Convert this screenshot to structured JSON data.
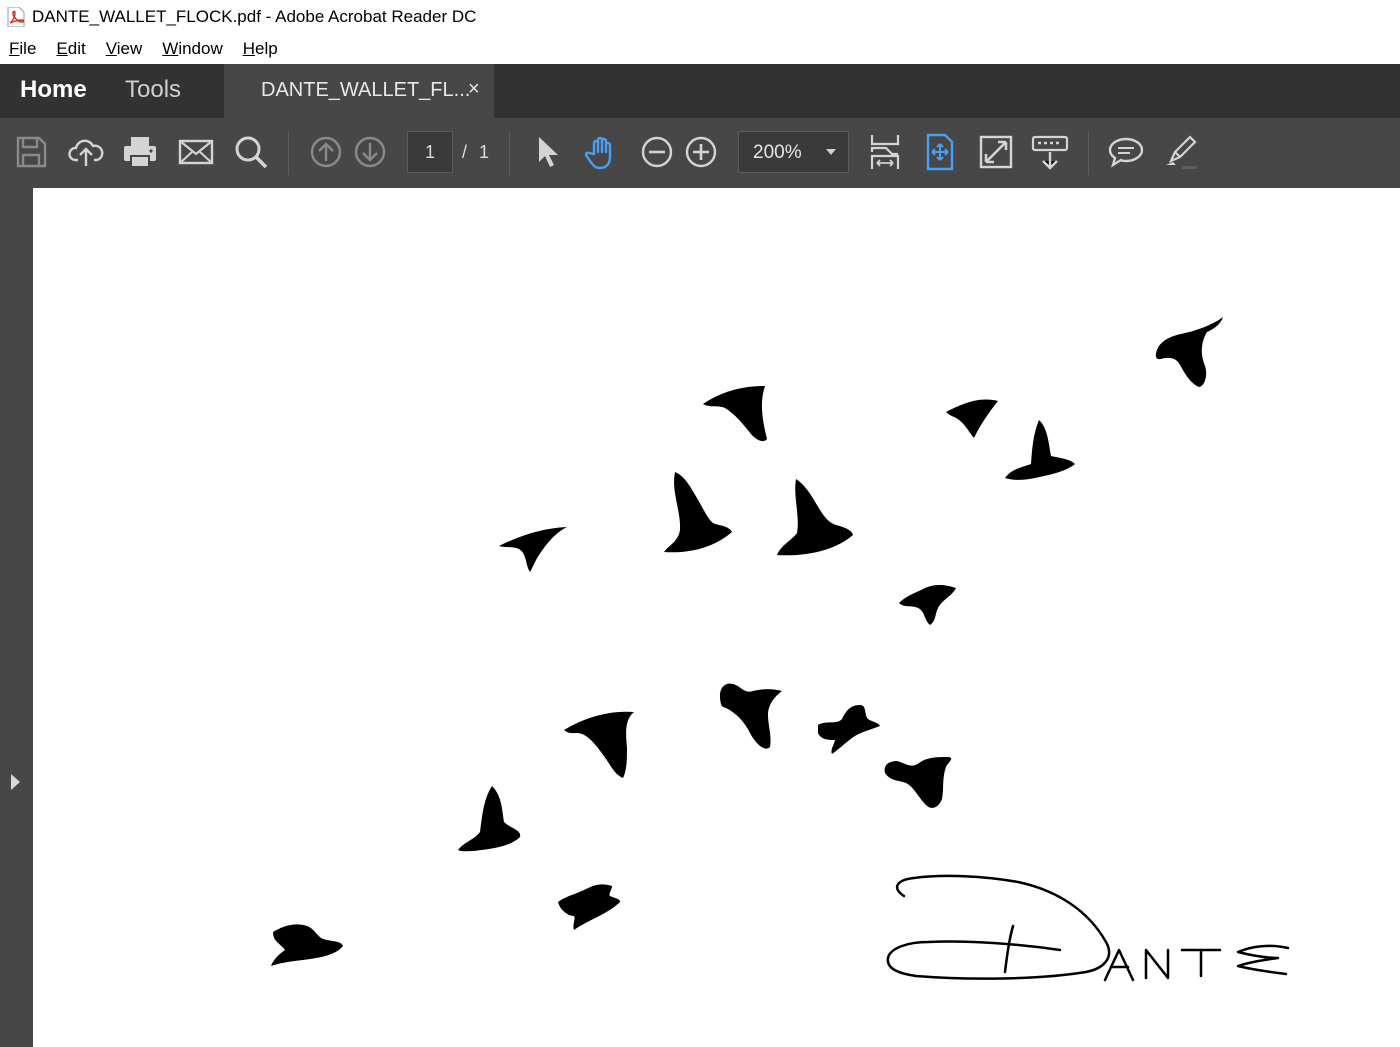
{
  "window": {
    "title": "DANTE_WALLET_FLOCK.pdf - Adobe Acrobat Reader DC",
    "icon": "pdf-file-icon",
    "accent_red": "#d9261c"
  },
  "menu": {
    "file": {
      "key": "F",
      "rest": "ile"
    },
    "edit": {
      "key": "E",
      "rest": "dit"
    },
    "view": {
      "key": "V",
      "rest": "iew"
    },
    "window": {
      "key": "W",
      "rest": "indow"
    },
    "help": {
      "key": "H",
      "rest": "elp"
    }
  },
  "tabs": {
    "home": "Home",
    "tools": "Tools",
    "document": "DANTE_WALLET_FL...",
    "close": "×"
  },
  "toolbar": {
    "icons": [
      "save-icon",
      "upload-cloud-icon",
      "print-icon",
      "email-icon",
      "search-icon",
      "prev-page-icon",
      "next-page-icon",
      "select-arrow-icon",
      "hand-tool-icon",
      "zoom-out-icon",
      "zoom-in-icon",
      "scroll-mode-icon",
      "fit-page-icon",
      "fullscreen-icon",
      "read-mode-icon",
      "comment-icon",
      "highlight-pen-icon"
    ],
    "page_current": "1",
    "page_separator": "/",
    "page_total": "1",
    "zoom": "200%",
    "active_color": "#4a9ff5"
  },
  "document": {
    "signature_text": "DANTE",
    "content": "flock of black bird silhouettes with handwritten signature"
  }
}
